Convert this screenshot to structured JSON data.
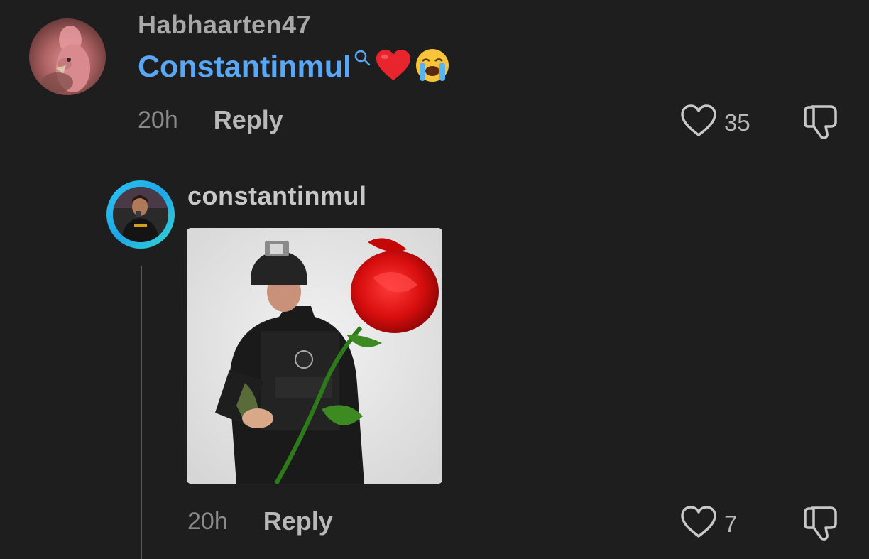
{
  "comment": {
    "username": "Habhaarten47",
    "mention": "Constantinmul",
    "emojis": [
      "red-heart",
      "loudly-crying-face"
    ],
    "time": "20h",
    "reply_label": "Reply",
    "likes": "35"
  },
  "reply": {
    "username": "constantinmul",
    "image": "soldier-holding-rose-sticker",
    "time": "20h",
    "reply_label": "Reply",
    "likes": "7"
  },
  "icons": {
    "like": "heart-outline-icon",
    "dislike": "thumbs-down-icon",
    "mention_search": "search-icon"
  },
  "colors": {
    "background": "#1e1e1e",
    "mention": "#5aa8f5",
    "avatar_ring": "#2bc6f0"
  }
}
